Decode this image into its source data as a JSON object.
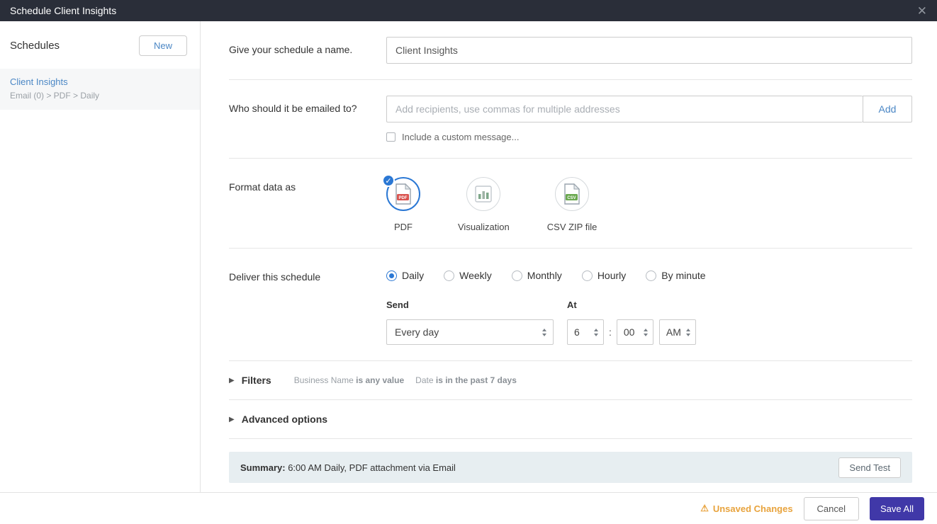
{
  "colors": {
    "header_bg": "#2a2e39",
    "accent_blue": "#2b78d4",
    "link_blue": "#4b87c5",
    "save_bg": "#4038a8",
    "warning": "#e8a33d",
    "summary_bg": "#e7eef1"
  },
  "header": {
    "title": "Schedule Client Insights",
    "close_icon": "✕"
  },
  "sidebar": {
    "heading": "Schedules",
    "new_button": "New",
    "items": [
      {
        "name": "Client Insights",
        "detail": "Email (0) > PDF > Daily",
        "selected": true
      }
    ]
  },
  "form": {
    "name_section": {
      "label": "Give your schedule a name.",
      "value": "Client Insights"
    },
    "email_section": {
      "label": "Who should it be emailed to?",
      "placeholder": "Add recipients, use commas for multiple addresses",
      "add_button": "Add",
      "custom_message_label": "Include a custom message..."
    },
    "format_section": {
      "label": "Format data as",
      "options": [
        {
          "label": "PDF",
          "badge": "PDF",
          "selected": true
        },
        {
          "label": "Visualization",
          "selected": false
        },
        {
          "label": "CSV ZIP file",
          "badge": "CSV",
          "selected": false
        }
      ],
      "check_glyph": "✓"
    },
    "deliver_section": {
      "label": "Deliver this schedule",
      "options": [
        "Daily",
        "Weekly",
        "Monthly",
        "Hourly",
        "By minute"
      ],
      "selected_option": "Daily",
      "send_label": "Send",
      "send_value": "Every day",
      "at_label": "At",
      "hour": "6",
      "time_separator": ":",
      "minute": "00",
      "meridiem": "AM"
    },
    "filters_section": {
      "label": "Filters",
      "items": [
        {
          "field": "Business Name",
          "condition": "is any value"
        },
        {
          "field": "Date",
          "condition": "is in the past 7 days"
        }
      ]
    },
    "advanced_section": {
      "label": "Advanced options"
    },
    "summary": {
      "prefix": "Summary:",
      "text": " 6:00 AM Daily, PDF attachment via Email",
      "send_test_button": "Send Test"
    }
  },
  "footer": {
    "unsaved_changes": "Unsaved Changes",
    "warning_glyph": "⚠",
    "cancel_button": "Cancel",
    "save_button": "Save All"
  }
}
